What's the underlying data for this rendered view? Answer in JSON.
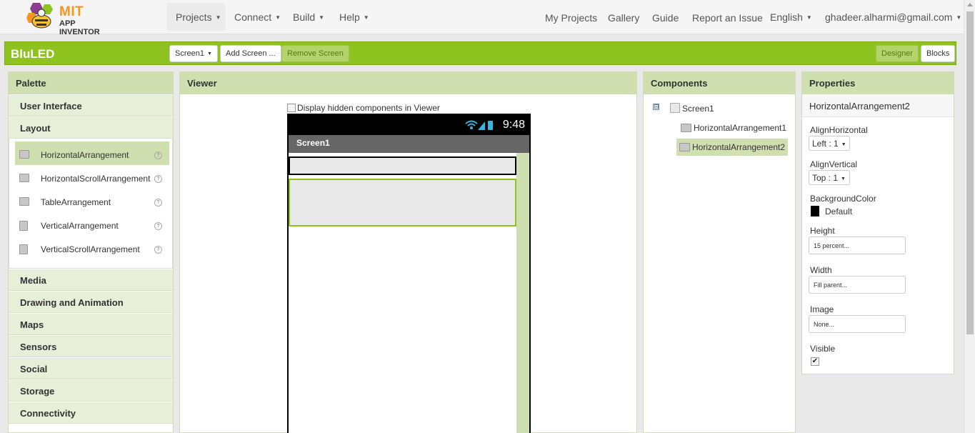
{
  "brand": {
    "title": "MIT",
    "subtitle": "APP INVENTOR"
  },
  "nav": {
    "left": [
      "Projects",
      "Connect",
      "Build",
      "Help"
    ],
    "right": {
      "my_projects": "My Projects",
      "gallery": "Gallery",
      "guide": "Guide",
      "report": "Report an Issue",
      "language": "English",
      "account": "ghadeer.alharmi@gmail.com"
    }
  },
  "toolbar": {
    "project_name": "BluLED",
    "screen_select": "Screen1",
    "add_screen": "Add Screen ...",
    "remove_screen": "Remove Screen",
    "designer": "Designer",
    "blocks": "Blocks"
  },
  "palette": {
    "header": "Palette",
    "categories_top": [
      "User Interface",
      "Layout"
    ],
    "layout_items": [
      "HorizontalArrangement",
      "HorizontalScrollArrangement",
      "TableArrangement",
      "VerticalArrangement",
      "VerticalScrollArrangement"
    ],
    "selected_item": "HorizontalArrangement",
    "help_glyph": "?",
    "categories_bottom": [
      "Media",
      "Drawing and Animation",
      "Maps",
      "Sensors",
      "Social",
      "Storage",
      "Connectivity"
    ]
  },
  "viewer": {
    "header": "Viewer",
    "hidden_toggle": "Display hidden components in Viewer",
    "hidden_checked": false,
    "clock": "9:48",
    "screen_title": "Screen1"
  },
  "components": {
    "header": "Components",
    "toggle": "⊟",
    "root": "Screen1",
    "children": [
      "HorizontalArrangement1",
      "HorizontalArrangement2"
    ],
    "selected": "HorizontalArrangement2"
  },
  "properties": {
    "header": "Properties",
    "component": "HorizontalArrangement2",
    "align_horizontal": {
      "label": "AlignHorizontal",
      "value": "Left : 1"
    },
    "align_vertical": {
      "label": "AlignVertical",
      "value": "Top : 1"
    },
    "background_color": {
      "label": "BackgroundColor",
      "value": "Default",
      "swatch": "#000000"
    },
    "height": {
      "label": "Height",
      "value": "15 percent..."
    },
    "width": {
      "label": "Width",
      "value": "Fill parent..."
    },
    "image": {
      "label": "Image",
      "value": "None..."
    },
    "visible": {
      "label": "Visible",
      "checked": true
    }
  },
  "colors": {
    "accent_green": "#8dc21f",
    "panel_header": "#cfdfb0",
    "brand_orange": "#f79422"
  }
}
